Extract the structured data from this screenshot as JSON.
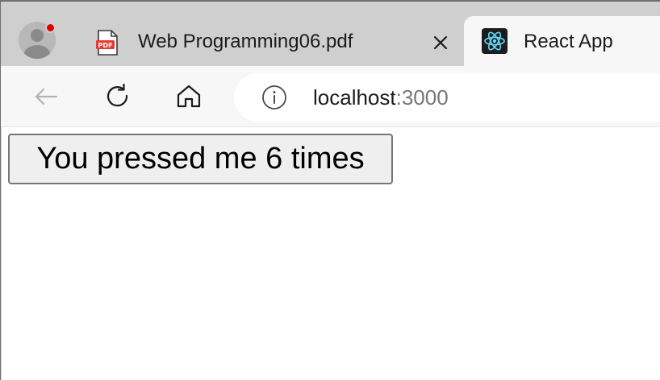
{
  "browser": {
    "tabs": [
      {
        "title": "Web Programming06.pdf",
        "icon": "pdf-icon",
        "active": false
      },
      {
        "title": "React App",
        "icon": "react-icon",
        "active": true
      }
    ],
    "tab_close_icon": "close-icon",
    "profile": {
      "icon": "avatar-icon",
      "notification": true,
      "notification_color": "#e00000"
    },
    "nav": {
      "back_icon": "back-arrow-icon",
      "reload_icon": "reload-icon",
      "home_icon": "home-icon"
    },
    "address_bar": {
      "info_icon": "info-icon",
      "host": "localhost",
      "port": ":3000"
    }
  },
  "page": {
    "counter_button_label": "You pressed me 6 times"
  },
  "colors": {
    "tabstrip_bg": "#cfcfcf",
    "toolbar_bg": "#f7f7f7",
    "react_accent": "#61dafb",
    "pdf_red": "#e53935"
  }
}
